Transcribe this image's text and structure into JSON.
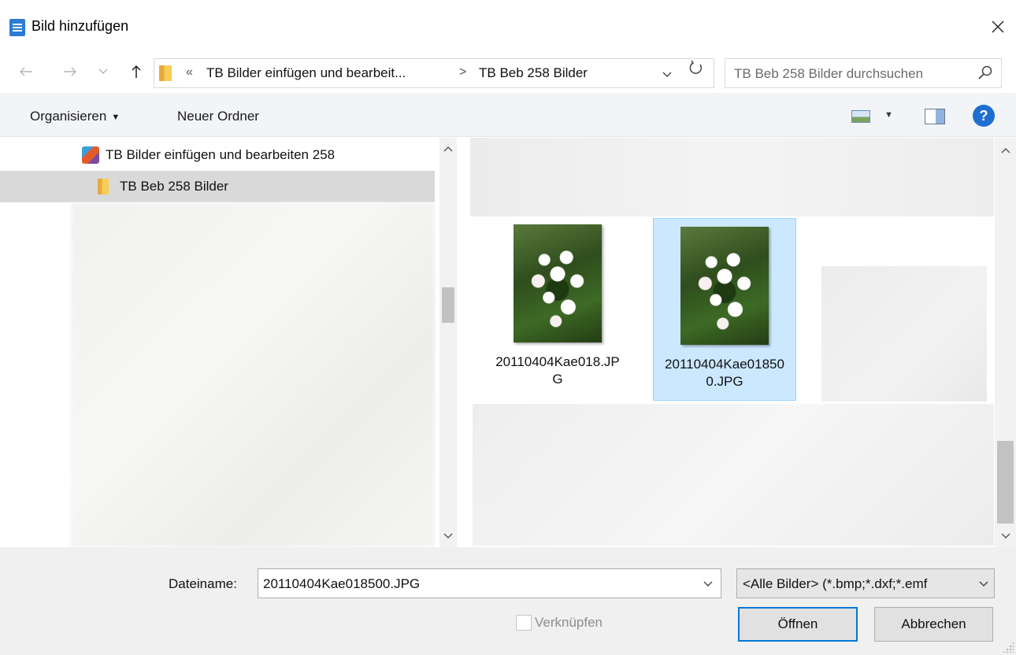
{
  "window": {
    "title": "Bild hinzufügen",
    "close_icon": "close-icon",
    "app_icon": "document-icon"
  },
  "navigation": {
    "back_icon": "arrow-left-icon",
    "forward_icon": "arrow-right-icon",
    "recent_icon": "chevron-down-icon",
    "up_icon": "arrow-up-icon",
    "breadcrumb": {
      "overflow": "«",
      "items": [
        "TB Bilder einfügen und bearbeit...",
        "TB Beb 258 Bilder"
      ],
      "separator": ">"
    },
    "refresh_icon": "refresh-icon",
    "search": {
      "placeholder": "TB Beb 258 Bilder durchsuchen",
      "icon": "search-icon"
    }
  },
  "toolbar": {
    "organize_label": "Organisieren",
    "new_folder_label": "Neuer Ordner",
    "view_icon": "view-options-icon",
    "preview_pane_icon": "preview-pane-icon",
    "help_label": "?"
  },
  "tree": {
    "items": [
      {
        "label": "TB Bilder einfügen und bearbeiten 258",
        "icon": "library-icon",
        "selected": false
      },
      {
        "label": "TB Beb 258 Bilder",
        "icon": "folder-icon",
        "selected": true
      }
    ]
  },
  "files": {
    "items": [
      {
        "name": "20110404Kae018.JPG",
        "selected": false
      },
      {
        "name": "20110404Kae018500.JPG",
        "selected": true
      }
    ]
  },
  "footer": {
    "filename_label": "Dateiname:",
    "filename_value": "20110404Kae018500.JPG",
    "filetype_value": "<Alle Bilder> (*.bmp;*.dxf;*.emf",
    "link_label": "Verknüpfen",
    "link_checked": false,
    "open_label": "Öffnen",
    "cancel_label": "Abbrechen"
  },
  "colors": {
    "accent": "#0078d7",
    "selection_bg": "#cce8ff",
    "selection_border": "#99d1ff",
    "help_blue": "#1e6fd0"
  }
}
